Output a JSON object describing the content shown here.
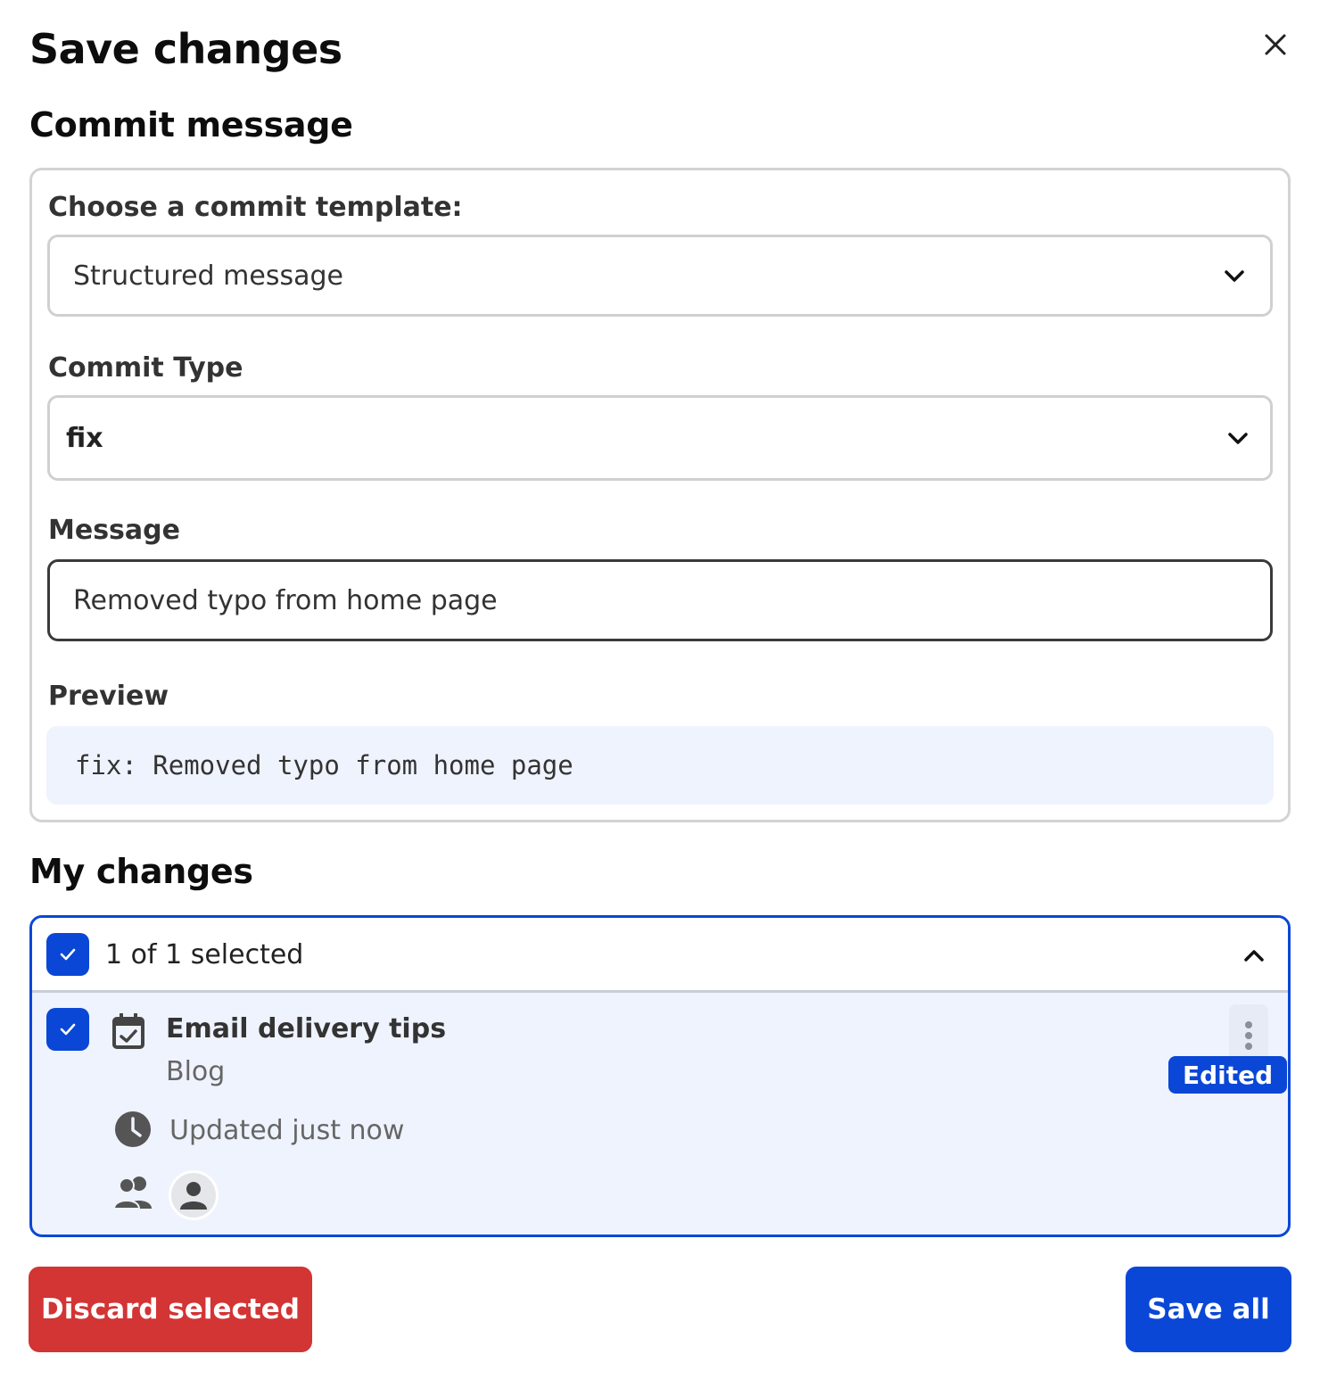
{
  "dialog": {
    "title": "Save changes",
    "close_icon": "close-icon"
  },
  "commit": {
    "section_title": "Commit message",
    "template_label": "Choose a commit template:",
    "template_value": "Structured message",
    "type_label": "Commit Type",
    "type_value": "fix",
    "message_label": "Message",
    "message_value": "Removed typo from home page",
    "preview_label": "Preview",
    "preview_value": "fix: Removed typo from home page"
  },
  "changes": {
    "section_title": "My changes",
    "selected_text": "1 of 1 selected",
    "items": [
      {
        "title": "Email delivery tips",
        "subtitle": "Blog",
        "updated": "Updated just now",
        "status": "Edited",
        "icon": "calendar-check-icon"
      }
    ]
  },
  "footer": {
    "discard_label": "Discard selected",
    "save_label": "Save all"
  },
  "colors": {
    "primary": "#0a47d6",
    "danger": "#d33434",
    "preview_bg": "#eef3fd"
  }
}
